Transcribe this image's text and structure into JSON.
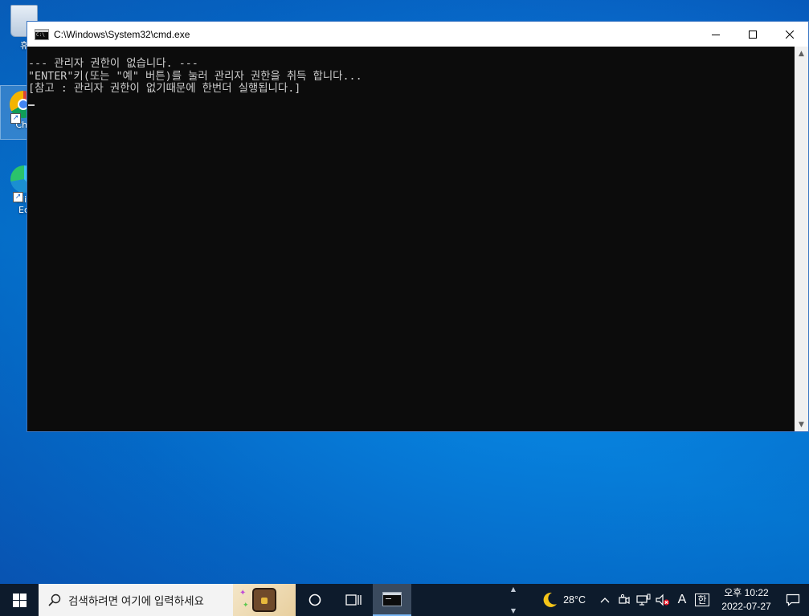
{
  "desktop": {
    "icons": [
      {
        "label": "휴",
        "name": "recycle-bin"
      },
      {
        "label": "Chr",
        "name": "chrome"
      },
      {
        "label": "Mic\nEd",
        "name": "edge"
      }
    ]
  },
  "window": {
    "title": "C:\\Windows\\System32\\cmd.exe",
    "console_lines": [
      "--- 관리자 권한이 없습니다. ---",
      "\"ENTER\"키(또는 \"예\" 버튼)를 눌러 관리자 권한을 취득 합니다...",
      "[참고 : 관리자 권한이 없기때문에 한번더 실행됩니다.]"
    ],
    "colors": {
      "background": "#0c0c0c",
      "text": "#cccccc"
    }
  },
  "taskbar": {
    "search_placeholder": "검색하려면 여기에 입력하세요",
    "weather_temp": "28°C",
    "ime_mode": "A",
    "ime_lang": "한",
    "clock_time": "오후 10:22",
    "clock_date": "2022-07-27"
  }
}
